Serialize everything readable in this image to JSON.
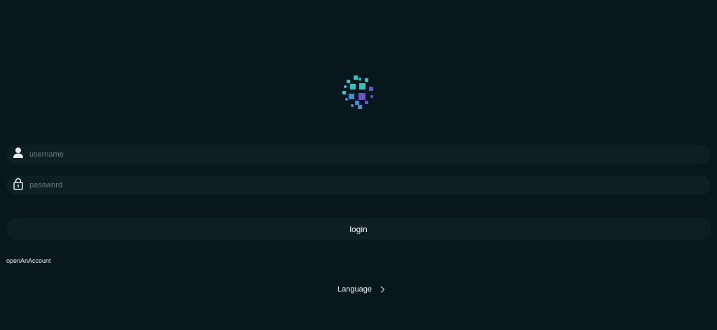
{
  "login_form": {
    "username": {
      "value": "",
      "placeholder": "username",
      "icon": "user-icon"
    },
    "password": {
      "value": "",
      "placeholder": "password",
      "icon": "lock-icon"
    },
    "login_label": "login",
    "open_account_label": "openAnAccount"
  },
  "footer": {
    "language_label": "Language",
    "language_icon": "chevron-right-icon"
  },
  "colors": {
    "background": "#08171b",
    "field_background": "#0d1f23",
    "logo_cyan": "#2ec4c4",
    "logo_blue": "#3f8fd4",
    "logo_purple": "#6b55c8"
  }
}
